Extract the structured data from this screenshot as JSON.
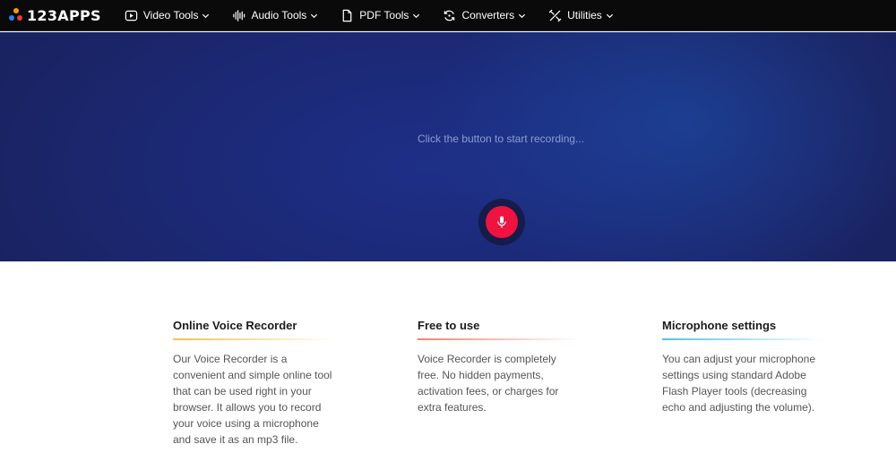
{
  "brand": {
    "name": "123APPS",
    "dot_colors": [
      "#ff9800",
      "#2f80ed",
      "#ea3d3d"
    ]
  },
  "nav": {
    "items": [
      {
        "label": "Video Tools",
        "icon": "play-circle-icon"
      },
      {
        "label": "Audio Tools",
        "icon": "waveform-icon"
      },
      {
        "label": "PDF Tools",
        "icon": "document-icon"
      },
      {
        "label": "Converters",
        "icon": "refresh-icon"
      },
      {
        "label": "Utilities",
        "icon": "tools-icon"
      }
    ]
  },
  "hero": {
    "prompt": "Click the button to start recording...",
    "record_icon": "microphone-icon",
    "record_color": "#f0123f"
  },
  "features": [
    {
      "title": "Online Voice Recorder",
      "text": "Our Voice Recorder is a convenient and simple online tool that can be used right in your browser. It allows you to record your voice using a microphone and save it as an mp3 file.",
      "accent": "#f5c242"
    },
    {
      "title": "Free to use",
      "text": "Voice Recorder is completely free. No hidden payments, activation fees, or charges for extra features.",
      "accent": "#f2836b"
    },
    {
      "title": "Microphone settings",
      "text": "You can adjust your microphone settings using standard Adobe Flash Player tools (decreasing echo and adjusting the volume).",
      "accent": "#4fc3e8"
    }
  ]
}
